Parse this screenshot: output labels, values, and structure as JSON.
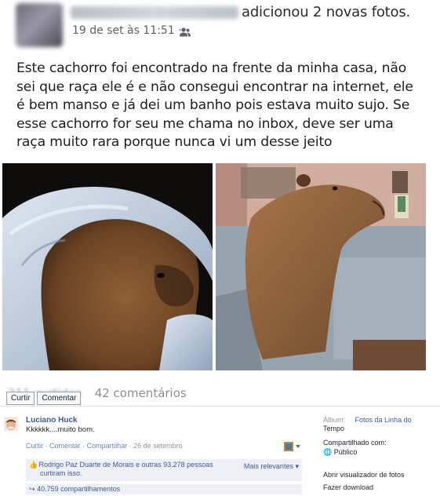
{
  "header": {
    "action_text": "adicionou 2 novas fotos.",
    "timestamp": "19 de set às 11:51",
    "separator": "·",
    "audience_icon": "friends-icon"
  },
  "post": {
    "text": "Este cachorro foi encontrado na frente da minha casa, não sei que raça ele é e não consegui encontrar na internet, ele é bem manso e já dei um banho pois estava muito sujo. Se esse cachorro for seu me chama no inbox, deve ser uma raça muito rara porque nunca vi um desse jeito"
  },
  "counts": {
    "likes_blurred": "211 curtidas",
    "comments": "42 comentários"
  },
  "action_buttons": {
    "like": "Curtir",
    "comment": "Comentar"
  },
  "comment": {
    "author": "Luciano Huck",
    "text": "Kkkkkk....muito bom.",
    "action_like": "Curtir",
    "action_comment": "Comentar",
    "action_share": "Compartilhar",
    "date": "26 de setembro",
    "dot": "·"
  },
  "likes": {
    "text_line1": "Rodrigo Paz Duarte de Morais e outras 93.278 pessoas",
    "text_line2": "curtiram isso.",
    "sort_label": "Mais relevantes",
    "shares": "40.759 compartilhamentos"
  },
  "sidebar": {
    "album_label": "Álbum:",
    "album_value_1": "Fotos da Linha do",
    "album_value_2": "Tempo",
    "shared_label": "Compartilhado com:",
    "shared_value": "Público",
    "open_viewer": "Abrir visualizador de fotos",
    "download": "Fazer download"
  },
  "colors": {
    "link": "#3b5998",
    "muted": "#90949c",
    "panel": "#eef0f5"
  }
}
